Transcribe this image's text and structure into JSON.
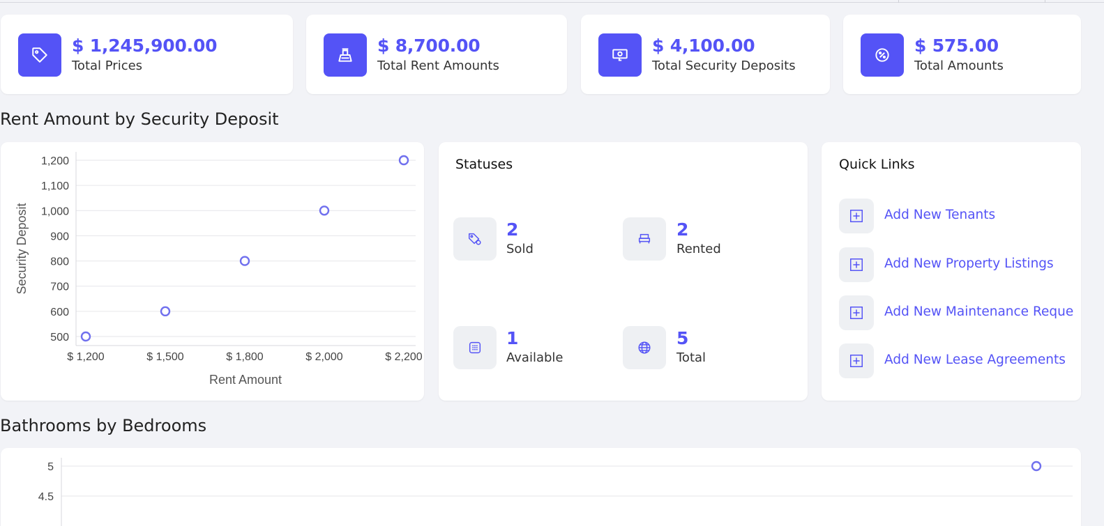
{
  "stats": [
    {
      "value": "$ 1,245,900.00",
      "label": "Total Prices",
      "icon": "price-tag-icon"
    },
    {
      "value": "$ 8,700.00",
      "label": "Total Rent Amounts",
      "icon": "cash-register-icon"
    },
    {
      "value": "$ 4,100.00",
      "label": "Total Security Deposits",
      "icon": "money-deposit-icon"
    },
    {
      "value": "$ 575.00",
      "label": "Total Amounts",
      "icon": "percent-icon"
    }
  ],
  "sections": {
    "rent_chart_title": "Rent Amount by Security Deposit",
    "bath_chart_title": "Bathrooms by Bedrooms"
  },
  "statuses": {
    "title": "Statuses",
    "items": [
      {
        "count": "2",
        "label": "Sold",
        "icon": "sold-tag-icon"
      },
      {
        "count": "2",
        "label": "Rented",
        "icon": "bed-icon"
      },
      {
        "count": "1",
        "label": "Available",
        "icon": "building-icon"
      },
      {
        "count": "5",
        "label": "Total",
        "icon": "globe-icon"
      }
    ]
  },
  "quick_links": {
    "title": "Quick Links",
    "items": [
      {
        "label": "Add New Tenants",
        "icon": "add-square-icon"
      },
      {
        "label": "Add New Property Listings",
        "icon": "add-square-icon"
      },
      {
        "label": "Add New Maintenance Requests",
        "icon": "add-square-icon"
      },
      {
        "label": "Add New Lease Agreements",
        "icon": "add-square-icon"
      }
    ]
  },
  "colors": {
    "accent": "#5453f6",
    "marker": "#7070ee",
    "background": "#f2f3f7"
  },
  "chart_data": [
    {
      "type": "scatter",
      "title": "Rent Amount by Security Deposit",
      "xlabel": "Rent Amount",
      "ylabel": "Security Deposit",
      "x": [
        1200,
        1500,
        1800,
        2000,
        2200
      ],
      "y": [
        500,
        600,
        800,
        1000,
        1200
      ],
      "x_ticks": [
        "$ 1,200",
        "$ 1,500",
        "$ 1,800",
        "$ 2,000",
        "$ 2,200"
      ],
      "y_ticks": [
        "500",
        "600",
        "700",
        "800",
        "900",
        "1,000",
        "1,100",
        "1,200"
      ],
      "grid": true
    },
    {
      "type": "scatter",
      "title": "Bathrooms by Bedrooms",
      "y_ticks_visible": [
        "5",
        "4.5"
      ],
      "points_visible": [
        {
          "y": 5
        }
      ],
      "grid": true
    }
  ]
}
